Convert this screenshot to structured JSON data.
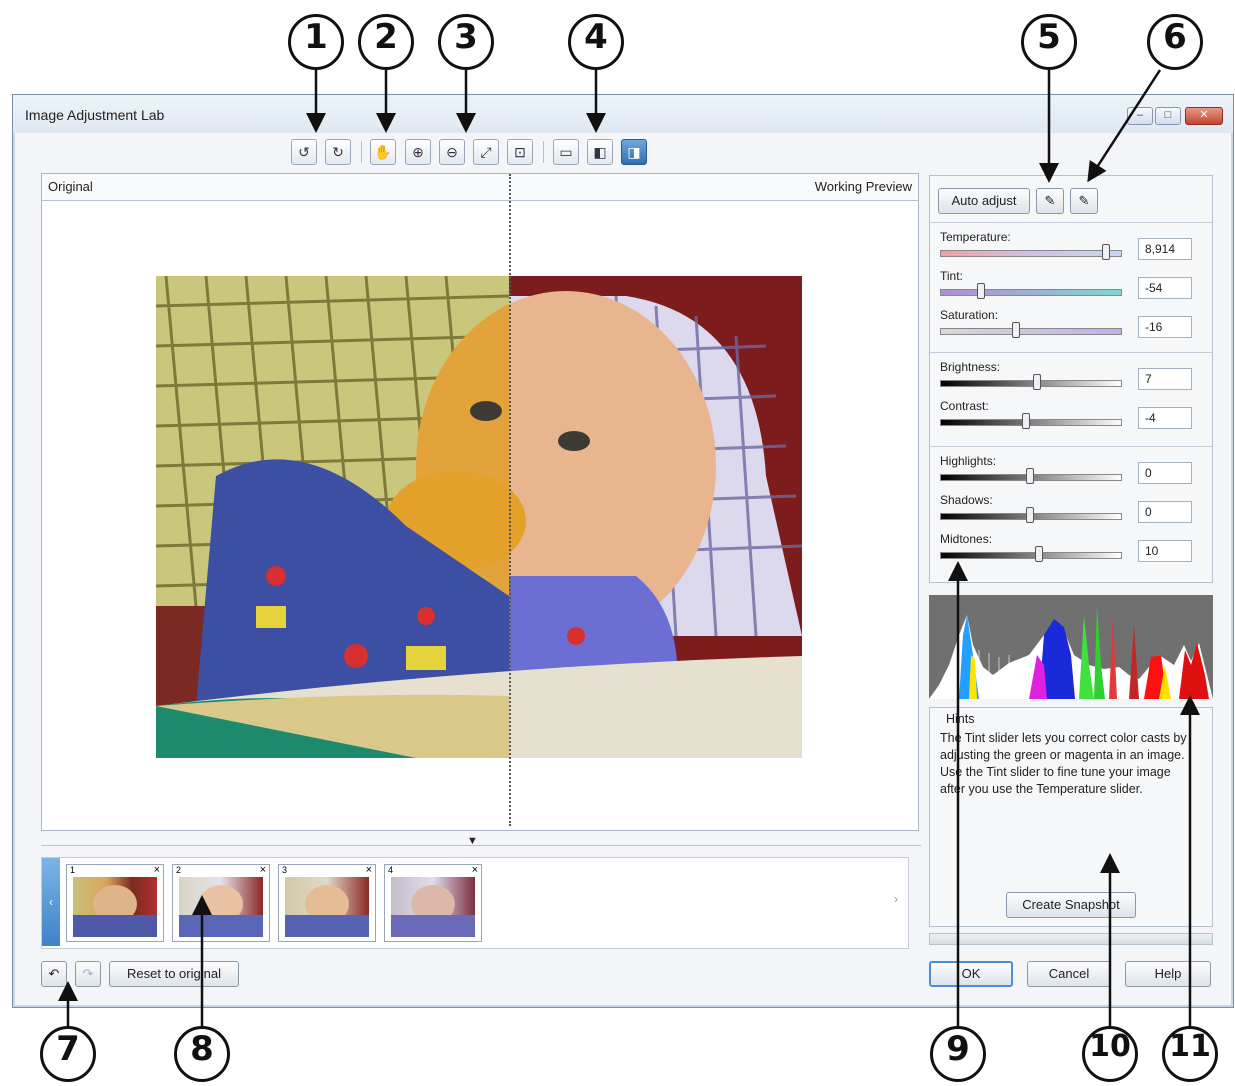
{
  "window": {
    "title": "Image Adjustment Lab",
    "controls": {
      "minimize": "–",
      "maximize": "□",
      "close": "✕"
    }
  },
  "callouts": [
    "1",
    "2",
    "3",
    "4",
    "5",
    "6",
    "7",
    "8",
    "9",
    "10",
    "11"
  ],
  "toolbar": {
    "rotate_left_icon": "↺",
    "rotate_right_icon": "↻",
    "pan_icon": "✋",
    "zoom_in_icon": "⊕",
    "zoom_out_icon": "⊖",
    "fit_icon": "⤢",
    "actual_size_icon": "⊡",
    "view_full_icon": "▭",
    "view_split_icon": "◧",
    "view_side_icon": "◨"
  },
  "preview": {
    "left_label": "Original",
    "right_label": "Working Preview",
    "collapse_glyph": "▼"
  },
  "snapshots": {
    "items": [
      {
        "number": "1",
        "close": "×"
      },
      {
        "number": "2",
        "close": "×"
      },
      {
        "number": "3",
        "close": "×"
      },
      {
        "number": "4",
        "close": "×"
      }
    ],
    "scroll_left": "‹",
    "scroll_right": "›"
  },
  "bottom_left": {
    "undo_icon": "↶",
    "redo_icon": "↷",
    "reset_label": "Reset to original"
  },
  "adjust": {
    "auto_adjust_label": "Auto adjust",
    "white_point_icon": "✎",
    "black_point_icon": "✎",
    "sliders": [
      {
        "label": "Temperature:",
        "value": "8,914",
        "level": 0.92
      },
      {
        "label": "Tint:",
        "value": "-54",
        "level": 0.23
      },
      {
        "label": "Saturation:",
        "value": "-16",
        "level": 0.42
      },
      {
        "label": "Brightness:",
        "value": "7",
        "level": 0.54
      },
      {
        "label": "Contrast:",
        "value": "-4",
        "level": 0.48
      },
      {
        "label": "Highlights:",
        "value": "0",
        "level": 0.5
      },
      {
        "label": "Shadows:",
        "value": "0",
        "level": 0.5
      },
      {
        "label": "Midtones:",
        "value": "10",
        "level": 0.55
      }
    ]
  },
  "hints": {
    "title": "Hints",
    "text": "The Tint slider lets you correct color casts by adjusting the green or magenta in an image. Use the Tint slider to fine tune your image after you use the Temperature slider.",
    "snapshot_button": "Create Snapshot"
  },
  "dialog_buttons": {
    "ok": "OK",
    "cancel": "Cancel",
    "help": "Help"
  },
  "colors": {
    "accent": "#4a90d9",
    "window_bg": "#f3f5f8",
    "histogram_bg": "#707070"
  }
}
